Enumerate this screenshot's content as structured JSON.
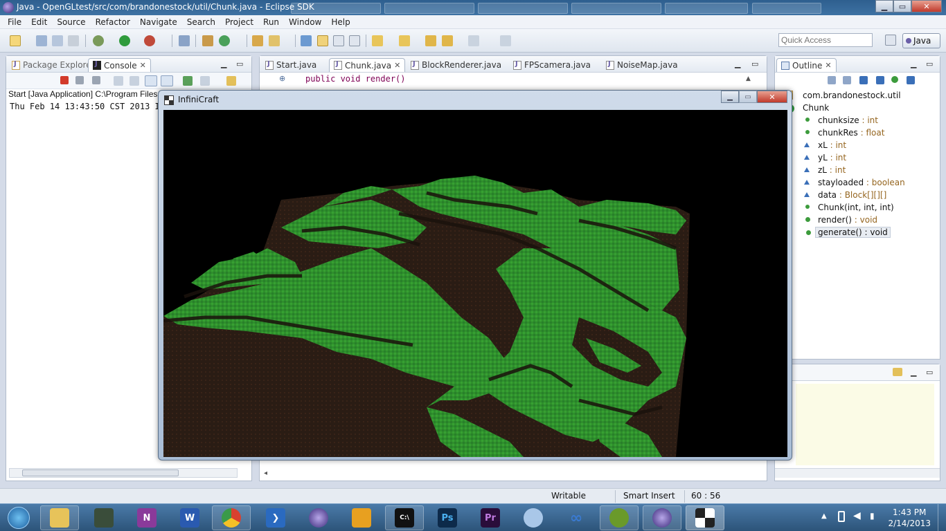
{
  "window": {
    "title": "Java - OpenGLtest/src/com/brandonestock/util/Chunk.java - Eclipse SDK",
    "minimize": "▁",
    "maximize": "▭",
    "close": "✕"
  },
  "menu": [
    "File",
    "Edit",
    "Source",
    "Refactor",
    "Navigate",
    "Search",
    "Project",
    "Run",
    "Window",
    "Help"
  ],
  "toolbar": {
    "quick_access_placeholder": "Quick Access",
    "perspective_label": "Java"
  },
  "left_panel": {
    "tabs": [
      {
        "label": "Package Explorer",
        "active": false
      },
      {
        "label": "Console",
        "active": true
      }
    ],
    "console_header": "Start [Java Application] C:\\Program Files",
    "console_line": "Thu Feb 14 13:43:50 CST 2013 IN"
  },
  "editor": {
    "tabs": [
      {
        "label": "Start.java",
        "active": false
      },
      {
        "label": "Chunk.java",
        "active": true
      },
      {
        "label": "BlockRenderer.java",
        "active": false
      },
      {
        "label": "FPScamera.java",
        "active": false
      },
      {
        "label": "NoiseMap.java",
        "active": false
      }
    ],
    "code_line": "public void render()"
  },
  "outline": {
    "title": "Outline",
    "package": "com.brandonestock.util",
    "class_name": "Chunk",
    "members": [
      {
        "name": "chunksize",
        "type": " : int",
        "icon": "static-field-icon"
      },
      {
        "name": "chunkRes",
        "type": " : float",
        "icon": "static-field-icon"
      },
      {
        "name": "xL",
        "type": " : int",
        "icon": "protected-field-icon"
      },
      {
        "name": "yL",
        "type": " : int",
        "icon": "protected-field-icon"
      },
      {
        "name": "zL",
        "type": " : int",
        "icon": "protected-field-icon"
      },
      {
        "name": "stayloaded",
        "type": " : boolean",
        "icon": "protected-field-icon"
      },
      {
        "name": "data",
        "type": " : Block[][][]",
        "icon": "protected-field-icon"
      },
      {
        "name": "Chunk(int, int, int)",
        "type": "",
        "icon": "constructor-icon"
      },
      {
        "name": "render()",
        "type": " : void",
        "icon": "method-icon"
      },
      {
        "name": "generate()",
        "type": " : void",
        "icon": "method-icon"
      }
    ]
  },
  "game_window": {
    "title": "InfiniCraft",
    "ground_color": "#2f8f2c",
    "dirt_color": "#2a1c14"
  },
  "status": {
    "writable": "Writable",
    "insert_mode": "Smart Insert",
    "position": "60 : 56"
  },
  "taskbar": {
    "time": "1:43 PM",
    "date": "2/14/2013"
  }
}
